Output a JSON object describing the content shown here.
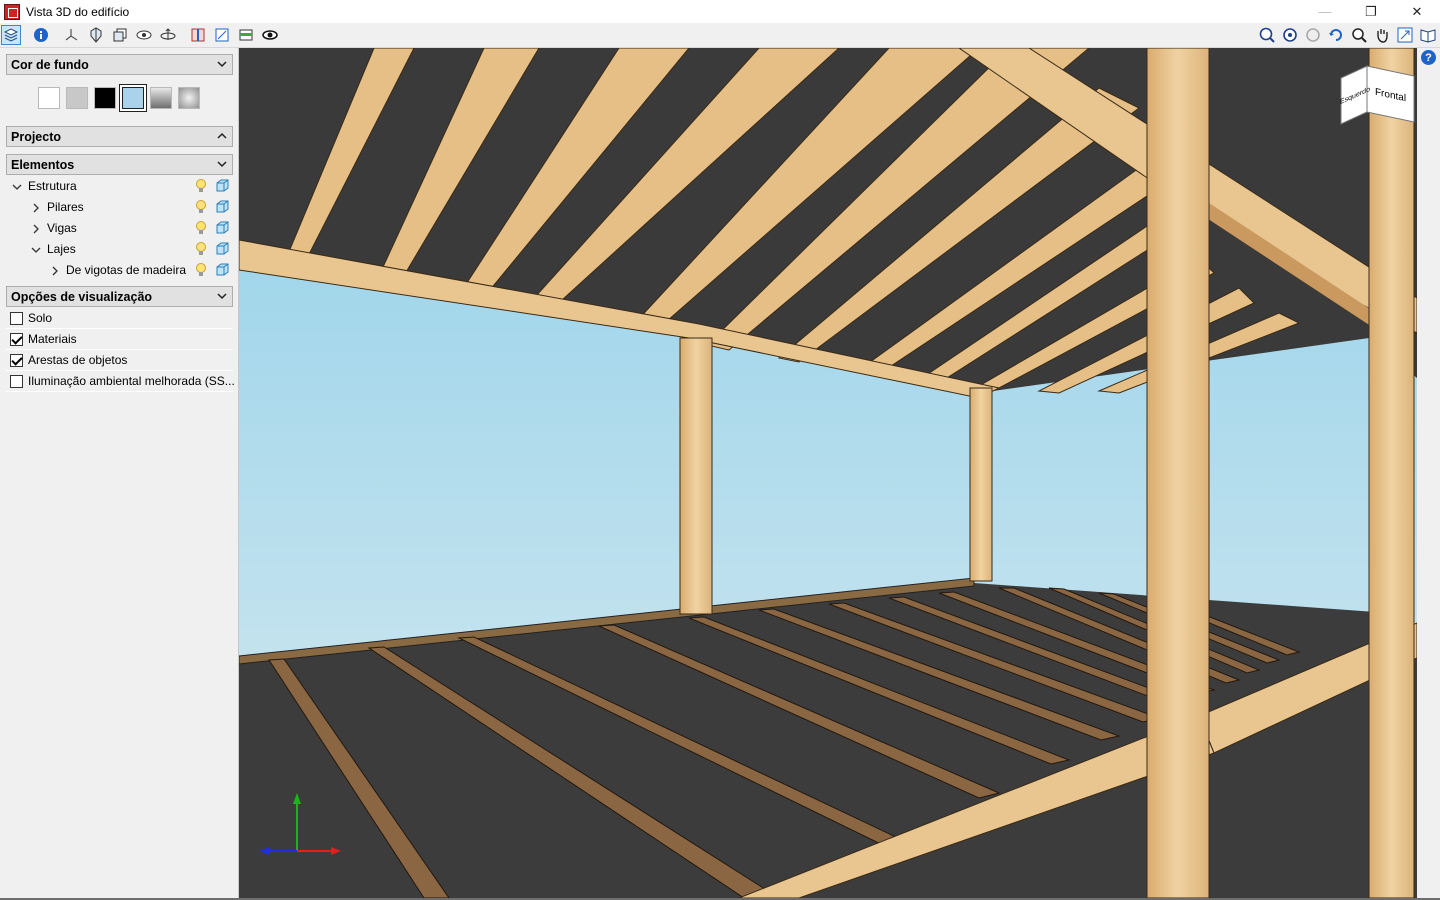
{
  "window": {
    "title": "Vista 3D do edifício",
    "minimize": "—",
    "restore": "❐",
    "close": "✕"
  },
  "toolbar": {
    "left_icons": [
      "layers-icon",
      "info-icon",
      "axes-icon",
      "shield-icon",
      "copy-view-icon",
      "eye-layers-icon",
      "orbit-icon",
      "section-icon",
      "zoom-window-icon",
      "floor-icon",
      "eye-icon"
    ],
    "right_icons": [
      "zoom-extents-icon",
      "zoom-all-icon",
      "zoom-disabled-icon",
      "rotate-icon",
      "zoom-icon",
      "pan-icon",
      "fit-icon",
      "book-icon"
    ]
  },
  "sidebar": {
    "background": {
      "header": "Cor de fundo",
      "swatches": [
        "#ffffff",
        "#c8c8c8",
        "#000000",
        "#a9d3ea",
        "gradient-grey",
        "gradient-light"
      ],
      "selected_index": 3
    },
    "project": {
      "header": "Projecto"
    },
    "elements": {
      "header": "Elementos",
      "tree": [
        {
          "label": "Estrutura",
          "level": 0,
          "expanded": true
        },
        {
          "label": "Pilares",
          "level": 1,
          "expanded": false
        },
        {
          "label": "Vigas",
          "level": 1,
          "expanded": false
        },
        {
          "label": "Lajes",
          "level": 1,
          "expanded": true
        },
        {
          "label": "De vigotas de madeira",
          "level": 2,
          "expanded": false
        }
      ]
    },
    "view_options": {
      "header": "Opções de visualização",
      "items": [
        {
          "label": "Solo",
          "checked": false
        },
        {
          "label": "Materiais",
          "checked": true
        },
        {
          "label": "Arestas de objetos",
          "checked": true
        },
        {
          "label": "Iluminação ambiental melhorada (SS...",
          "checked": false
        }
      ]
    }
  },
  "viewcube": {
    "left_face": "Esquerdo",
    "front_face": "Frontal"
  },
  "help": "?",
  "colors": {
    "sky_top": "#8ecfe8",
    "sky_bottom": "#cfe6ef",
    "wood": "#e9c58f",
    "wood_dark": "#b98f57",
    "slab": "#3e3e3e",
    "accent": "#1e63c6"
  }
}
